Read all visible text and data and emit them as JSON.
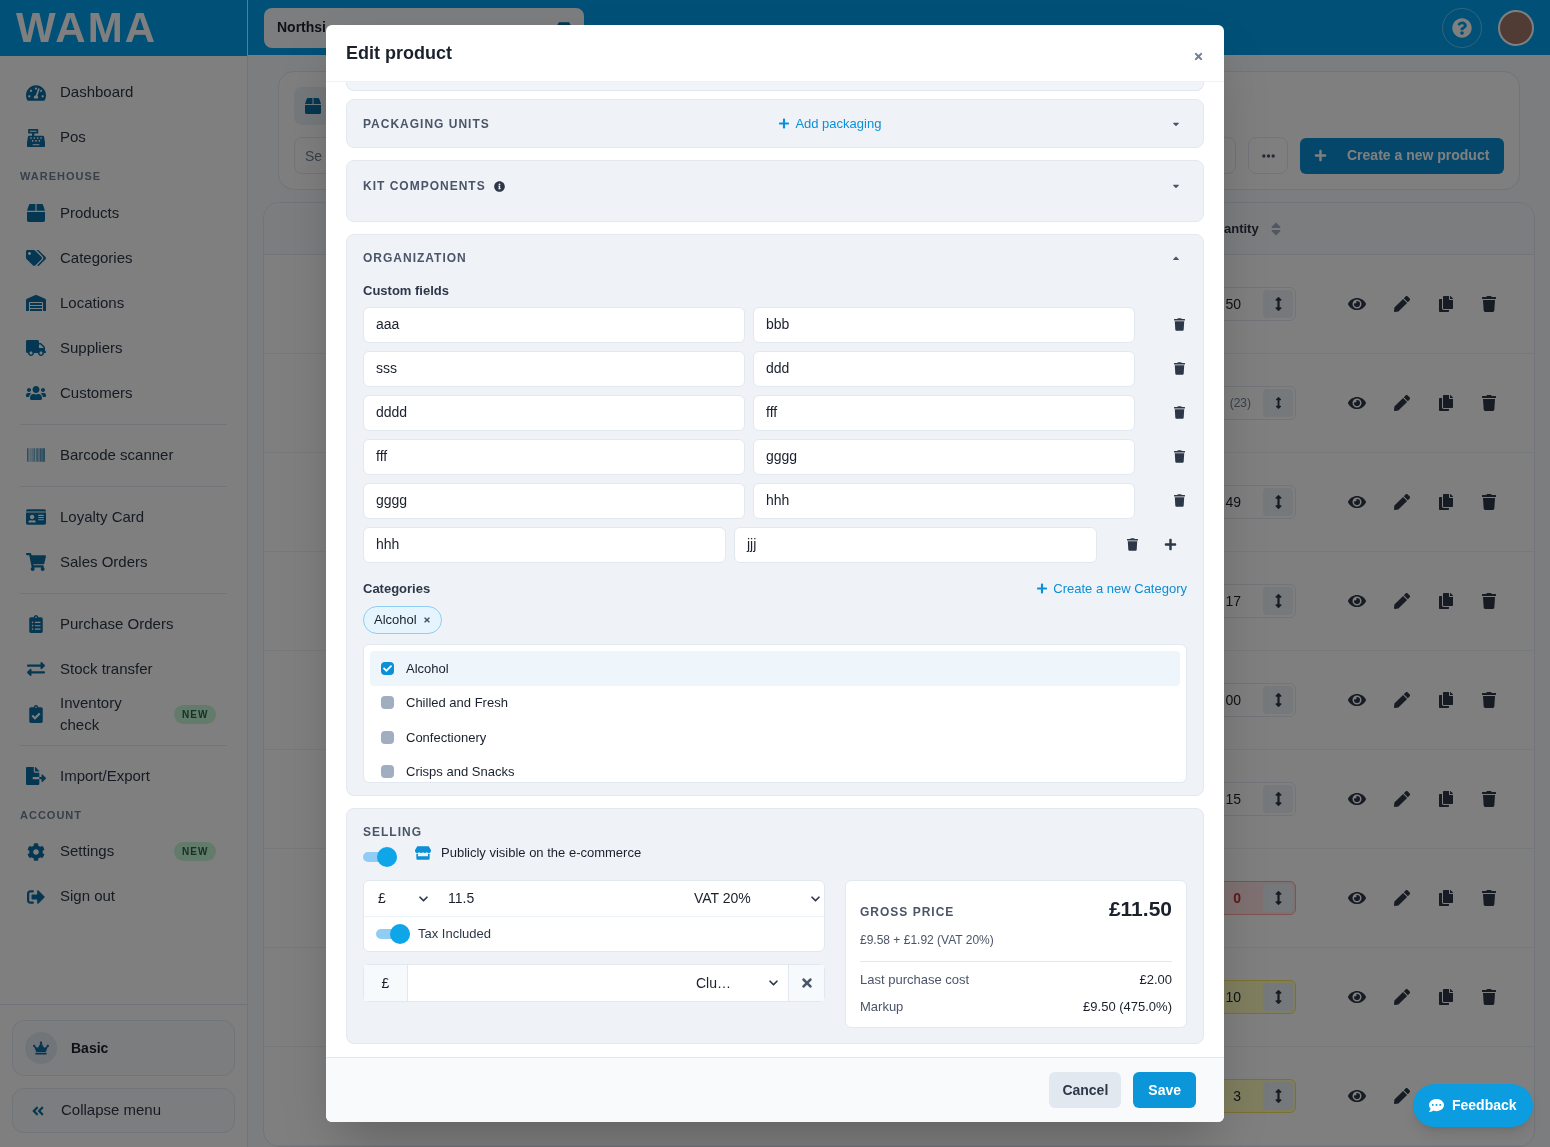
{
  "app": {
    "logo": "WAMA",
    "store": "Northsi"
  },
  "sidebar": {
    "groups": [
      {
        "divider_before": false,
        "items": [
          {
            "label": "Dashboard"
          },
          {
            "label": "Pos"
          }
        ]
      },
      {
        "divider_before": false,
        "heading": "WAREHOUSE",
        "items": [
          {
            "label": "Products"
          },
          {
            "label": "Categories"
          },
          {
            "label": "Locations"
          },
          {
            "label": "Suppliers"
          },
          {
            "label": "Customers"
          }
        ]
      },
      {
        "divider_before": true,
        "items": [
          {
            "label": "Barcode scanner"
          }
        ]
      },
      {
        "divider_before": true,
        "items": [
          {
            "label": "Loyalty Card"
          },
          {
            "label": "Sales Orders"
          }
        ]
      },
      {
        "divider_before": true,
        "items": [
          {
            "label": "Purchase Orders"
          },
          {
            "label": "Stock transfer"
          },
          {
            "label": "Inventory check",
            "badge": "NEW"
          }
        ]
      },
      {
        "divider_before": true,
        "items": [
          {
            "label": "Import/Export"
          }
        ]
      },
      {
        "divider_before": false,
        "heading": "ACCOUNT",
        "items": [
          {
            "label": "Settings",
            "badge": "NEW"
          },
          {
            "label": "Sign out"
          }
        ]
      }
    ],
    "plan": "Basic",
    "collapse": "Collapse menu"
  },
  "toolbar": {
    "search_placeholder": "Se",
    "create_label": "Create a new product"
  },
  "table": {
    "column_header": "antity",
    "rows": [
      {
        "quantity": "50",
        "kind": "normal"
      },
      {
        "quantity": "(23)",
        "kind": "reserved"
      },
      {
        "quantity": "49",
        "kind": "normal"
      },
      {
        "quantity": "17",
        "kind": "normal"
      },
      {
        "quantity": "00",
        "kind": "normal"
      },
      {
        "quantity": "15",
        "kind": "normal"
      },
      {
        "quantity": "0",
        "kind": "empty"
      },
      {
        "quantity": "10",
        "kind": "low"
      },
      {
        "quantity": "3",
        "kind": "low"
      }
    ]
  },
  "modal": {
    "title": "Edit product",
    "packaging": {
      "title": "PACKAGING UNITS",
      "add_label": "Add packaging",
      "expanded": false
    },
    "kit": {
      "title": "KIT COMPONENTS",
      "expanded": false
    },
    "organization": {
      "title": "ORGANIZATION",
      "expanded": true,
      "custom_fields_label": "Custom fields",
      "custom_fields": [
        {
          "key": "aaa",
          "value": "bbb"
        },
        {
          "key": "sss",
          "value": "ddd"
        },
        {
          "key": "dddd",
          "value": "fff"
        },
        {
          "key": "fff",
          "value": "gggg"
        },
        {
          "key": "gggg",
          "value": "hhh"
        },
        {
          "key": "hhh",
          "value": "jjj"
        }
      ],
      "categories_label": "Categories",
      "create_category_label": "Create a new Category",
      "chips": [
        "Alcohol"
      ],
      "options": [
        {
          "label": "Alcohol",
          "checked": true
        },
        {
          "label": "Chilled and Fresh",
          "checked": false
        },
        {
          "label": "Confectionery",
          "checked": false
        },
        {
          "label": "Crisps and Snacks",
          "checked": false
        }
      ]
    },
    "selling": {
      "title": "SELLING",
      "public": {
        "on": true,
        "label": "Publicly visible on the e-commerce"
      },
      "price": {
        "currency": "£",
        "value": "11.5",
        "vat": "VAT 20%"
      },
      "tax_included": {
        "on": true,
        "label": "Tax Included"
      },
      "cost": {
        "currency": "£",
        "supplier": "Clu…"
      },
      "gross": {
        "label": "GROSS PRICE",
        "amount": "£11.50",
        "breakdown": "£9.58 + £1.92 (VAT 20%)",
        "rows": [
          {
            "label": "Last purchase cost",
            "value": "£2.00"
          },
          {
            "label": "Markup",
            "value": "£9.50 (475.0%)"
          }
        ]
      }
    },
    "cancel": "Cancel",
    "save": "Save"
  },
  "feedback": "Feedback"
}
